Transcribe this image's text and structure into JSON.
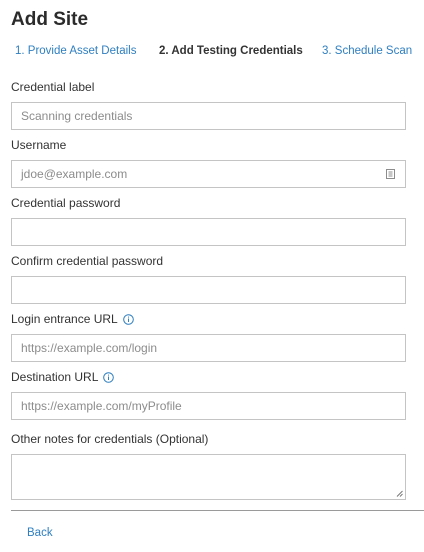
{
  "page": {
    "title": "Add Site"
  },
  "steps": [
    {
      "label": "1. Provide Asset Details",
      "state": "link"
    },
    {
      "label": "2. Add Testing Credentials",
      "state": "active"
    },
    {
      "label": "3. Schedule Scan",
      "state": "link"
    }
  ],
  "form": {
    "credential_label": {
      "label": "Credential label",
      "value": "",
      "placeholder": "Scanning credentials"
    },
    "username": {
      "label": "Username",
      "value": "",
      "placeholder": "jdoe@example.com",
      "icon": "contact-card-icon"
    },
    "password": {
      "label": "Credential password",
      "value": ""
    },
    "confirm_password": {
      "label": "Confirm credential password",
      "value": ""
    },
    "login_url": {
      "label": "Login entrance URL",
      "value": "",
      "placeholder": "https://example.com/login",
      "icon": "info-icon"
    },
    "destination_url": {
      "label": "Destination URL",
      "value": "",
      "placeholder": "https://example.com/myProfile",
      "icon": "info-icon"
    },
    "notes": {
      "label": "Other notes for credentials (Optional)",
      "value": ""
    }
  },
  "footer": {
    "back_label": "Back"
  },
  "colors": {
    "link": "#2f7fc1",
    "text": "#333333",
    "border": "#c4c4c4",
    "placeholder": "#8c8c8c"
  }
}
